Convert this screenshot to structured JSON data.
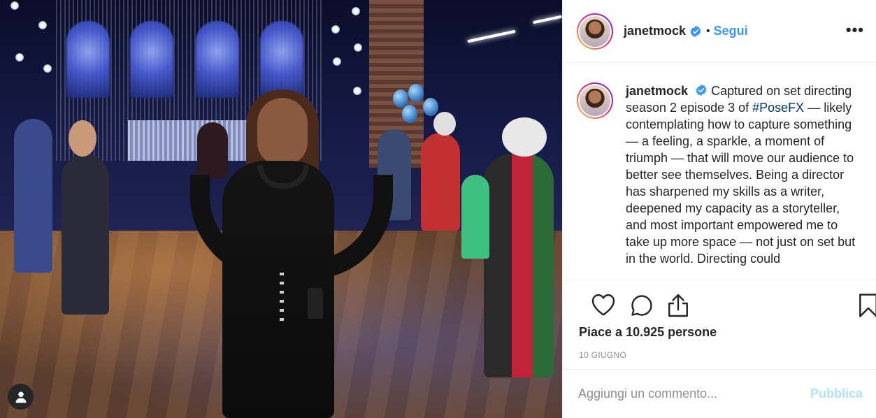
{
  "post": {
    "username": "janetmock",
    "separator": "•",
    "follow_label": "Segui",
    "more_glyph": "•••",
    "caption": {
      "author": "janetmock",
      "text_before": " Captured on set directing season 2 episode 3 of ",
      "hashtag": "#PoseFX",
      "text_after": " — likely contemplating how to capture something — a feeling, a sparkle, a moment of triumph — that will move our audience to better see themselves. Being a director has sharpened my skills as a writer, deepened my capacity as a storyteller, and most important empowered me to take up more space — not just on set but in the world. Directing could"
    },
    "likes_prefix": "Piace a ",
    "likes_count": "10.925",
    "likes_suffix": " persone",
    "date": "10 GIUGNO",
    "comment_placeholder": "Aggiungi un commento...",
    "publish_label": "Pubblica"
  },
  "icons": {
    "verified": "verified-badge-icon",
    "like": "heart-icon",
    "comment": "comment-icon",
    "share": "share-icon",
    "save": "bookmark-icon",
    "user": "user-tag-icon"
  },
  "colors": {
    "accent": "#3897f0",
    "text": "#262626",
    "muted": "#8e8e8e",
    "publish_disabled": "#b2dffc",
    "hashtag": "#00376b"
  }
}
